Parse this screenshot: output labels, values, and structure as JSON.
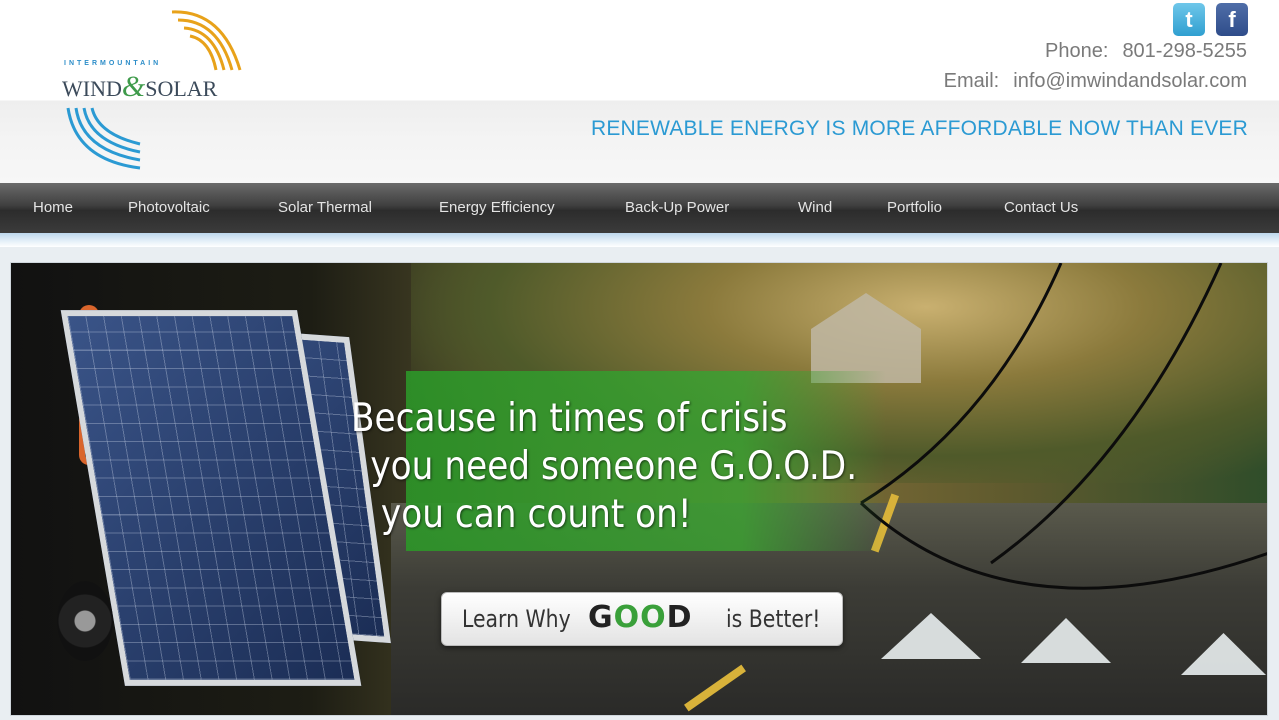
{
  "logo": {
    "top_text": "INTERMOUNTAIN",
    "word1": "WIND",
    "amp": "&",
    "word2": "SOLAR"
  },
  "social": {
    "twitter_glyph": "t",
    "facebook_glyph": "f"
  },
  "contact": {
    "phone_label": "Phone:",
    "phone_value": "801-298-5255",
    "email_label": "Email:",
    "email_value": "info@imwindandsolar.com"
  },
  "tagline": "RENEWABLE ENERGY IS MORE AFFORDABLE NOW THAN EVER",
  "nav": {
    "items": [
      {
        "label": "Home"
      },
      {
        "label": "Photovoltaic"
      },
      {
        "label": "Solar Thermal"
      },
      {
        "label": "Energy Efficiency"
      },
      {
        "label": "Back-Up Power"
      },
      {
        "label": "Wind"
      },
      {
        "label": "Portfolio"
      },
      {
        "label": "Contact Us"
      }
    ]
  },
  "banner": {
    "headline": [
      "Because in times of crisis",
      "you need someone G.O.O.D.",
      "you can count on!"
    ],
    "cta": {
      "pre": "Learn Why",
      "good_left": "G",
      "good_mid": "OO",
      "good_right": "D",
      "post": "is Better!"
    }
  },
  "icons": {
    "twitter": "twitter-icon",
    "facebook": "facebook-icon"
  },
  "colors": {
    "accent_blue": "#2b9ad3",
    "nav_dark": "#3a3a3a",
    "good_green": "#3aa03a"
  }
}
